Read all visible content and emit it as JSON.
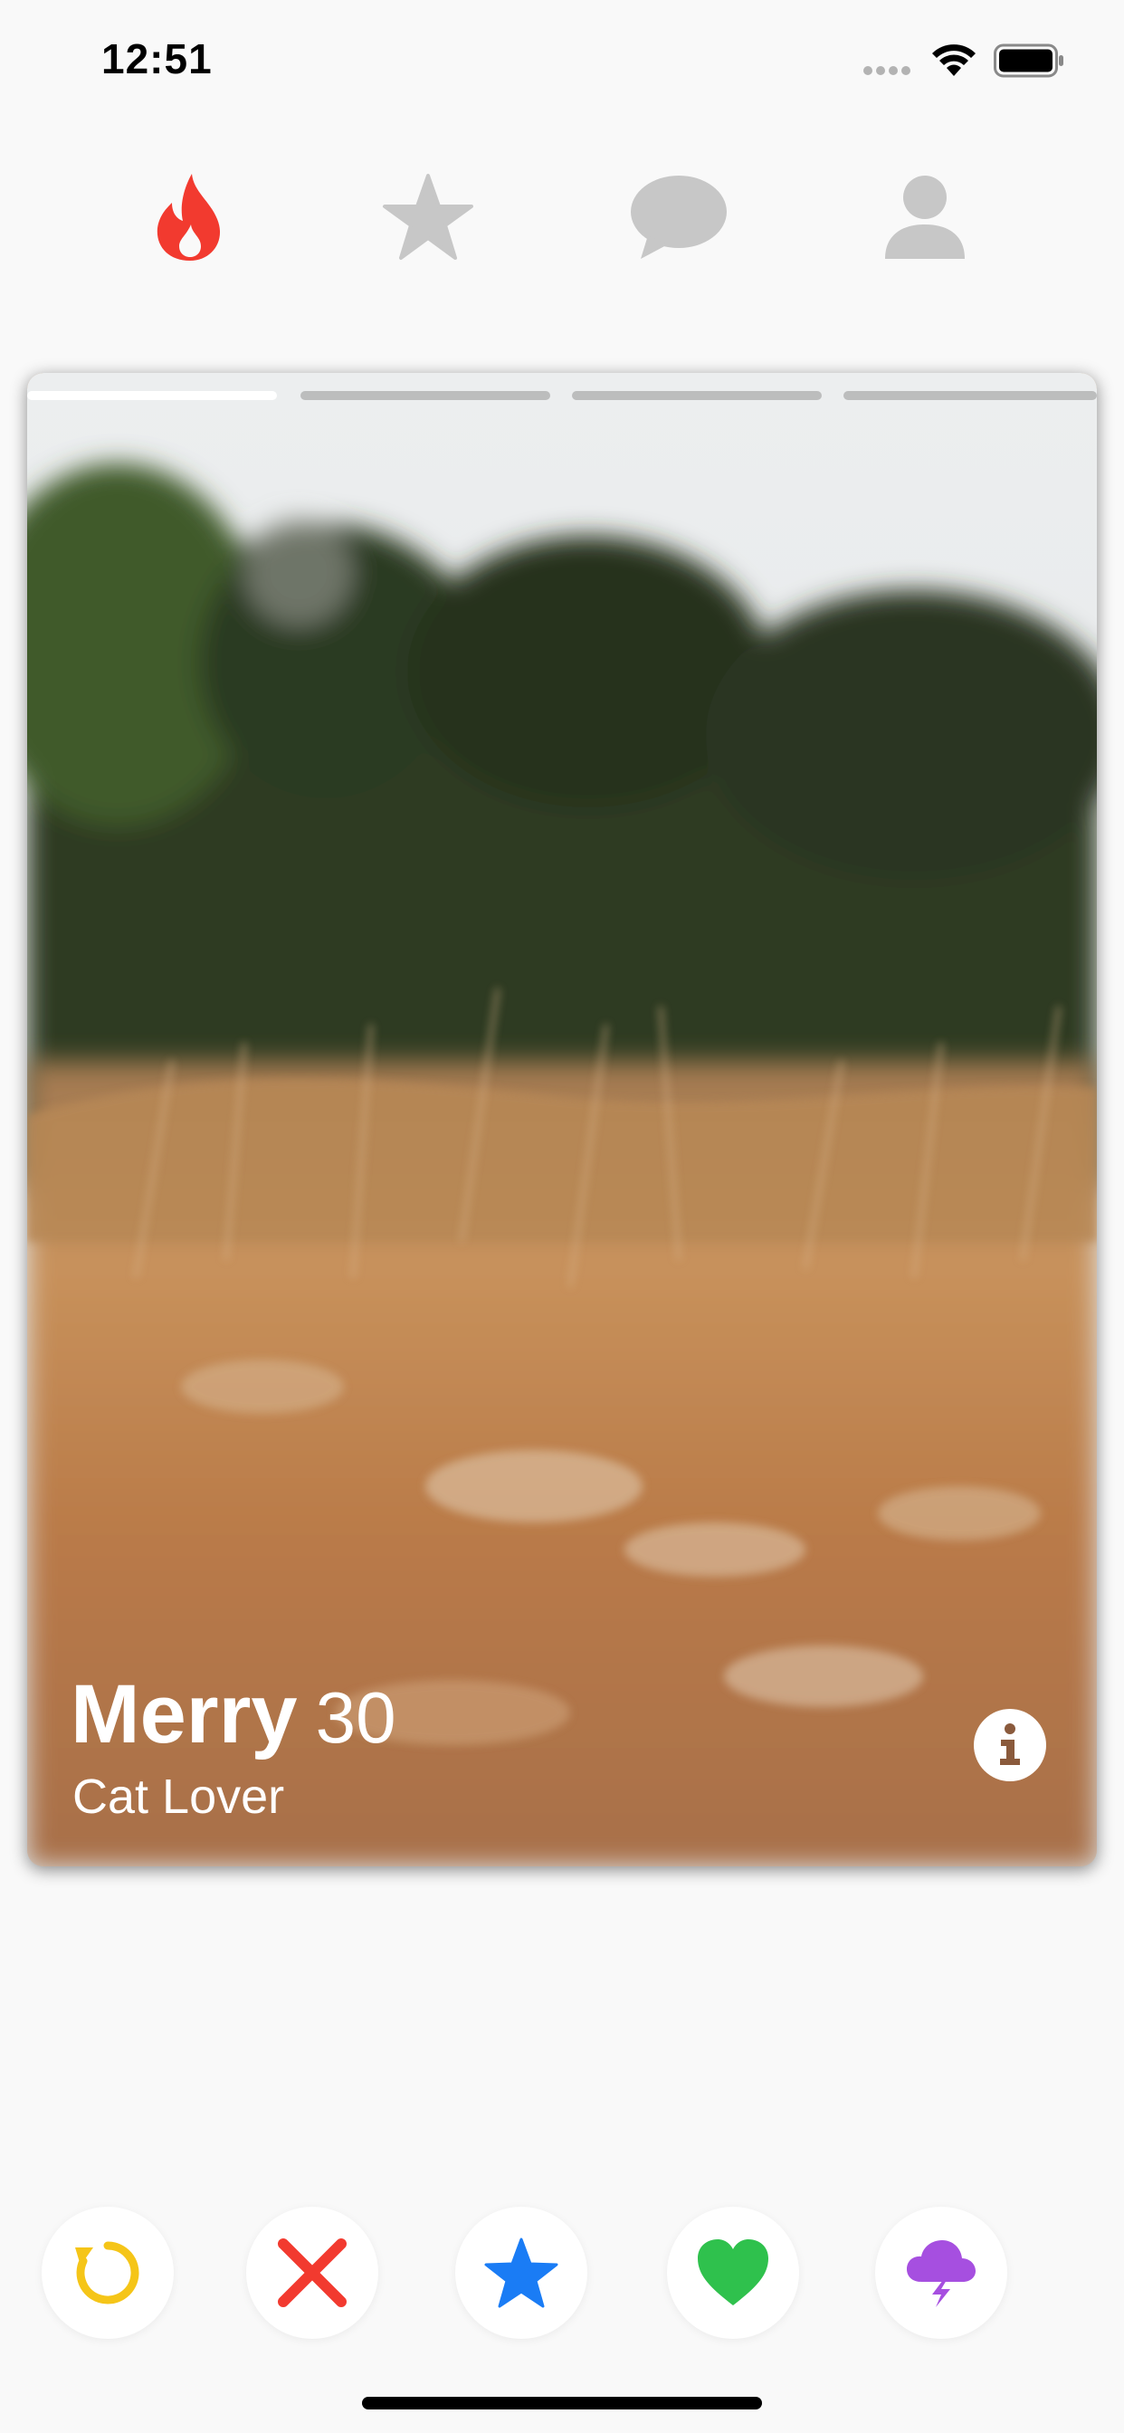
{
  "status_bar": {
    "time": "12:51"
  },
  "top_nav": {
    "items": [
      {
        "name": "discover",
        "icon": "flame-icon",
        "color": "#f23a2f",
        "active": true
      },
      {
        "name": "top-picks",
        "icon": "star-icon",
        "color": "#c7c7c7",
        "active": false
      },
      {
        "name": "messages",
        "icon": "chat-bubble-icon",
        "color": "#c7c7c7",
        "active": false
      },
      {
        "name": "profile",
        "icon": "person-icon",
        "color": "#c7c7c7",
        "active": false
      }
    ]
  },
  "card": {
    "name": "Merry",
    "age": "30",
    "bio": "Cat Lover",
    "photo_count": 4,
    "current_photo": 1,
    "info_icon": "info-icon"
  },
  "actions": [
    {
      "name": "rewind",
      "icon": "rewind-icon",
      "color": "#f5c518"
    },
    {
      "name": "nope",
      "icon": "x-icon",
      "color": "#f23a2f"
    },
    {
      "name": "super-like",
      "icon": "star-icon",
      "color": "#1a7cf5"
    },
    {
      "name": "like",
      "icon": "heart-icon",
      "color": "#2fc14d"
    },
    {
      "name": "boost",
      "icon": "storm-cloud-icon",
      "color": "#a64fe0"
    }
  ]
}
